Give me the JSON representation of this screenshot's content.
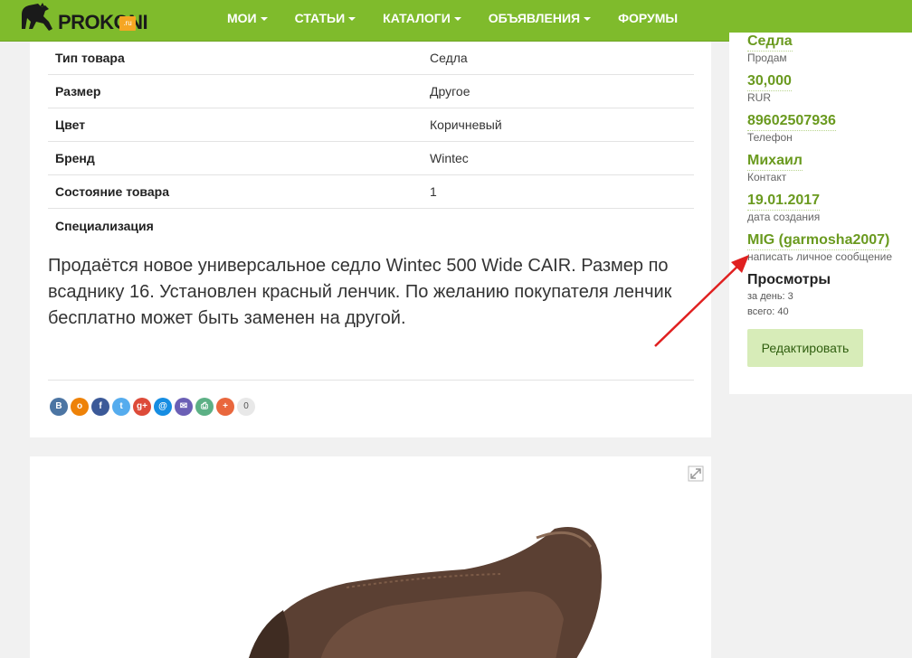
{
  "navbar": {
    "logo_text": "PROKONI",
    "logo_badge": ".ru",
    "items": [
      {
        "label": "МОИ"
      },
      {
        "label": "СТАТЬИ"
      },
      {
        "label": "КАТАЛОГИ"
      },
      {
        "label": "ОБЪЯВЛЕНИЯ"
      },
      {
        "label": "ФОРУМЫ"
      }
    ]
  },
  "properties": [
    {
      "key": "Тип товара",
      "value": "Седла"
    },
    {
      "key": "Размер",
      "value": "Другое"
    },
    {
      "key": "Цвет",
      "value": "Коричневый"
    },
    {
      "key": "Бренд",
      "value": "Wintec"
    },
    {
      "key": "Состояние товара",
      "value": "1"
    },
    {
      "key": "Специализация",
      "value": ""
    }
  ],
  "description": "Продаётся новое универсальное седло Wintec 500 Wide CAIR. Размер по всаднику 16. Установлен красный ленчик. По желанию покупателя ленчик бесплатно может быть заменен на другой.",
  "share": {
    "buttons": [
      {
        "icon": "vk-icon",
        "glyph": "В",
        "color": "#4c75a3"
      },
      {
        "icon": "odnoklassniki-icon",
        "glyph": "о",
        "color": "#ee8208"
      },
      {
        "icon": "facebook-icon",
        "glyph": "f",
        "color": "#3b5998"
      },
      {
        "icon": "twitter-icon",
        "glyph": "t",
        "color": "#55acee"
      },
      {
        "icon": "google-plus-icon",
        "glyph": "g+",
        "color": "#dd4b39"
      },
      {
        "icon": "mailru-icon",
        "glyph": "@",
        "color": "#168de2"
      },
      {
        "icon": "email-icon",
        "glyph": "✉",
        "color": "#6b5fb5"
      },
      {
        "icon": "print-icon",
        "glyph": "⎙",
        "color": "#5cb085"
      },
      {
        "icon": "more-icon",
        "glyph": "+",
        "color": "#e9673d"
      }
    ],
    "count": "0"
  },
  "sidebar": {
    "category": {
      "value": "Седла",
      "label": "Продам"
    },
    "price": {
      "value": "30,000",
      "label": "RUR"
    },
    "phone": {
      "value": "89602507936",
      "label": "Телефон"
    },
    "contact": {
      "value": "Михаил",
      "label": "Контакт"
    },
    "created": {
      "value": "19.01.2017",
      "label": "дата создания"
    },
    "author": {
      "value": "MIG (garmosha2007)",
      "label": "написать личное сообщение"
    },
    "views": {
      "heading": "Просмотры",
      "per_day": "за день: 3",
      "total": "всего: 40"
    },
    "edit_label": "Редактировать"
  },
  "colors": {
    "brand_green": "#7fbb2c",
    "link_green": "#6a9a1f",
    "arrow_red": "#e02020"
  }
}
